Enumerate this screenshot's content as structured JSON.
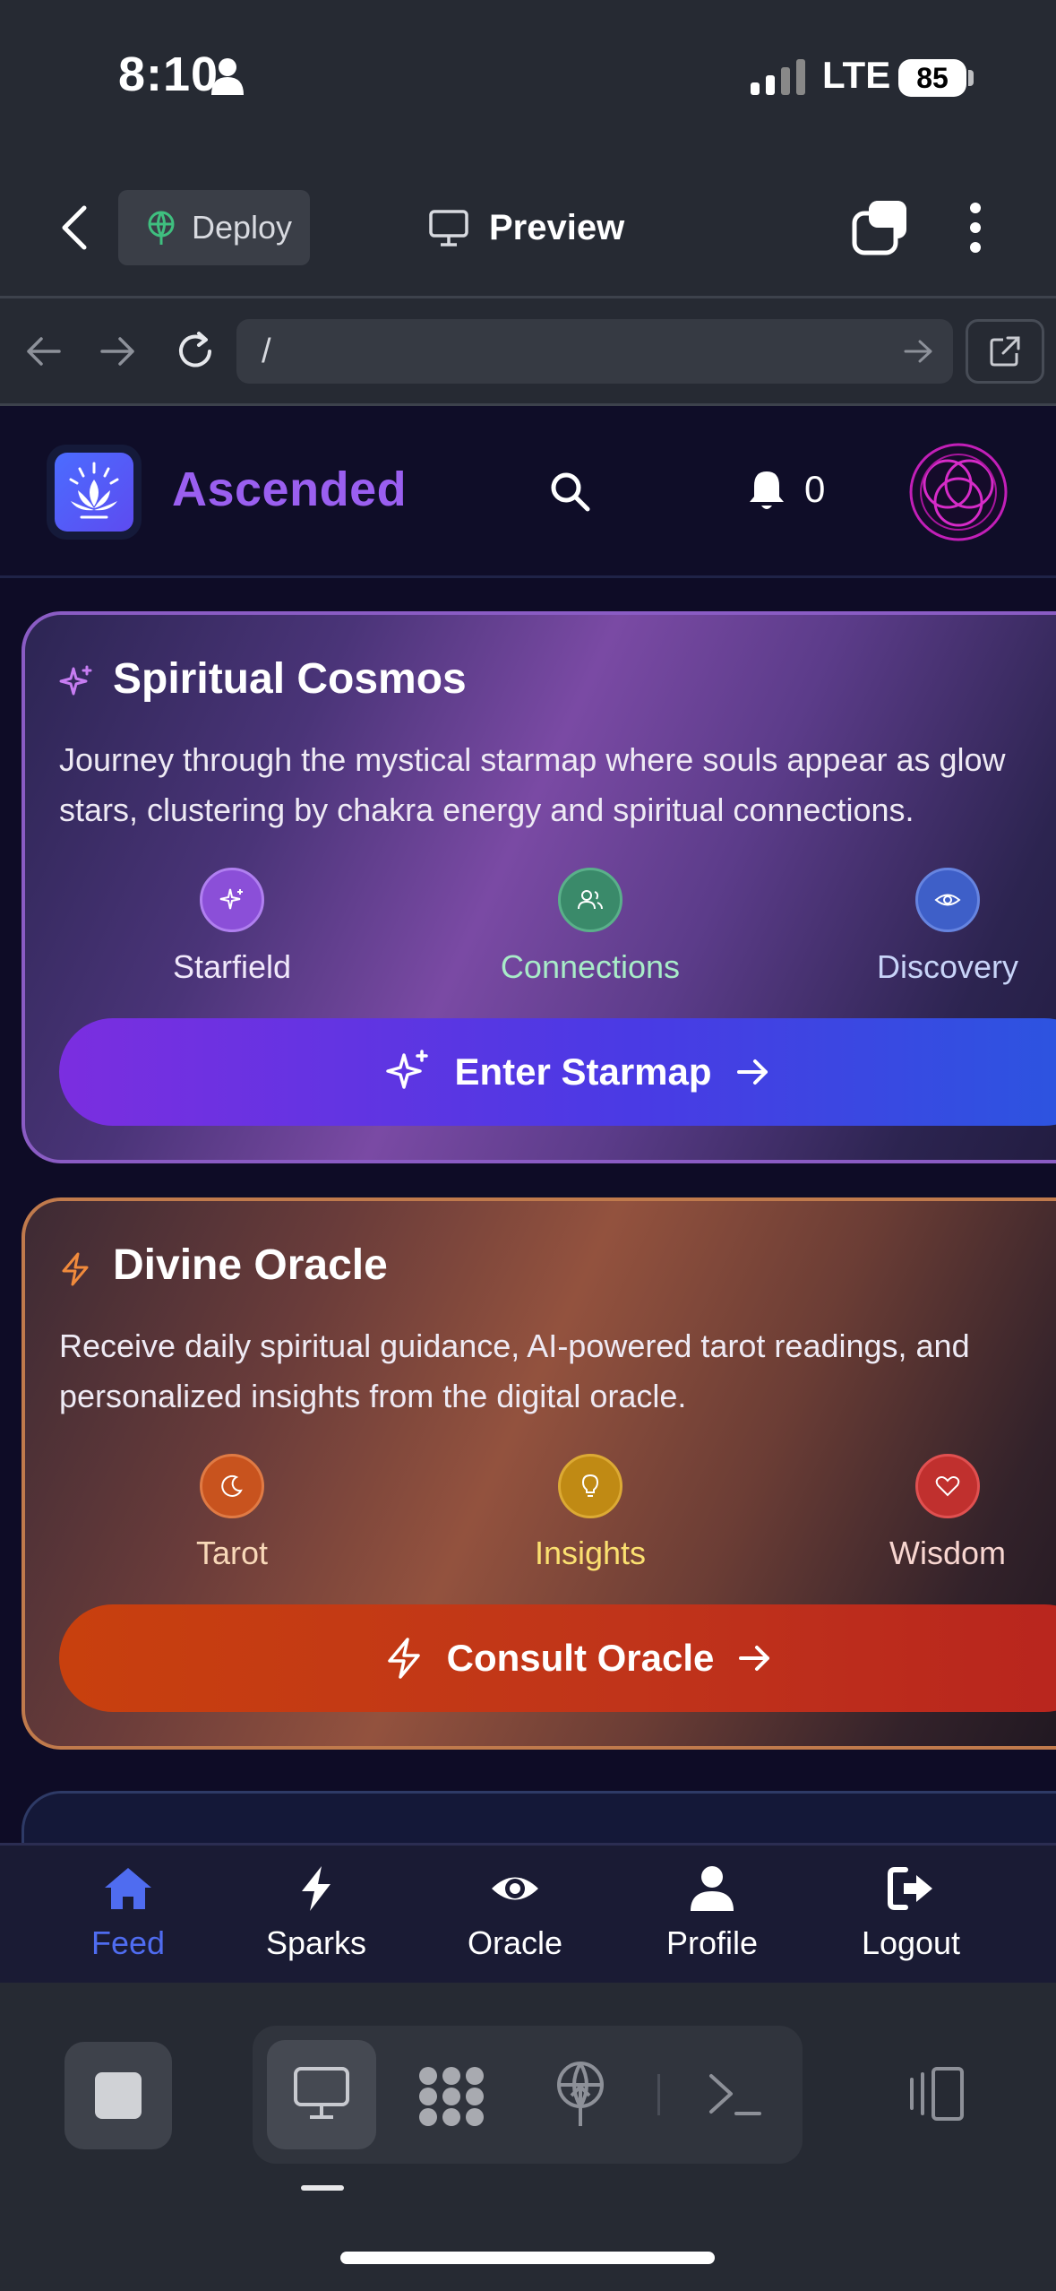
{
  "status_bar": {
    "time": "8:10",
    "network": "LTE",
    "battery": "85"
  },
  "app_bar": {
    "deploy_label": "Deploy",
    "preview_label": "Preview"
  },
  "url_bar": {
    "path": "/"
  },
  "app": {
    "brand": "Ascended",
    "notification_count": "0",
    "cards": [
      {
        "title": "Spiritual Cosmos",
        "description_line1": "Journey through the mystical starmap where souls appear as glow",
        "description_line2": "stars, clustering by chakra energy and spiritual connections.",
        "features": [
          {
            "label": "Starfield",
            "icon": "sparkle-icon",
            "color": "#8b4fd8"
          },
          {
            "label": "Connections",
            "icon": "users-icon",
            "color": "#3a8a6a"
          },
          {
            "label": "Discovery",
            "icon": "eye-icon",
            "color": "#3e5fc8"
          }
        ],
        "button_label": "Enter Starmap"
      },
      {
        "title": "Divine Oracle",
        "description_line1": "Receive daily spiritual guidance, AI-powered tarot readings, and",
        "description_line2": "personalized insights from the digital oracle.",
        "features": [
          {
            "label": "Tarot",
            "icon": "moon-icon",
            "color": "#c8531e"
          },
          {
            "label": "Insights",
            "icon": "lightbulb-icon",
            "color": "#c08a14"
          },
          {
            "label": "Wisdom",
            "icon": "heart-icon",
            "color": "#c0302e"
          }
        ],
        "button_label": "Consult Oracle"
      }
    ]
  },
  "bottom_nav": [
    {
      "label": "Feed",
      "icon": "home-icon",
      "active": true
    },
    {
      "label": "Sparks",
      "icon": "bolt-icon",
      "active": false
    },
    {
      "label": "Oracle",
      "icon": "eye-icon",
      "active": false
    },
    {
      "label": "Profile",
      "icon": "user-icon",
      "active": false
    },
    {
      "label": "Logout",
      "icon": "logout-icon",
      "active": false
    }
  ],
  "colors": {
    "accent": "#4f6cf0",
    "brand": "#9a5ff0",
    "app_bg": "#0e0c26"
  }
}
